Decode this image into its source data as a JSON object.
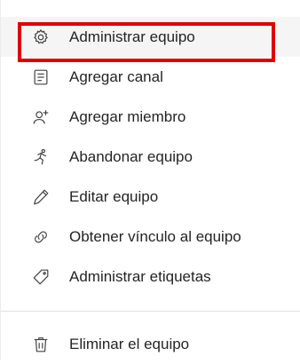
{
  "menu": {
    "items": [
      {
        "label": "Administrar equipo",
        "icon": "gear-icon"
      },
      {
        "label": "Agregar canal",
        "icon": "channel-icon"
      },
      {
        "label": "Agregar miembro",
        "icon": "add-person-icon"
      },
      {
        "label": "Abandonar equipo",
        "icon": "leave-icon"
      },
      {
        "label": "Editar equipo",
        "icon": "pencil-icon"
      },
      {
        "label": "Obtener vínculo al equipo",
        "icon": "link-icon"
      },
      {
        "label": "Administrar etiquetas",
        "icon": "tag-icon"
      }
    ],
    "danger_items": [
      {
        "label": "Eliminar el equipo",
        "icon": "trash-icon"
      }
    ]
  },
  "colors": {
    "highlight_border": "#e00000",
    "hover_background": "#f5f5f5",
    "text": "#242424"
  }
}
